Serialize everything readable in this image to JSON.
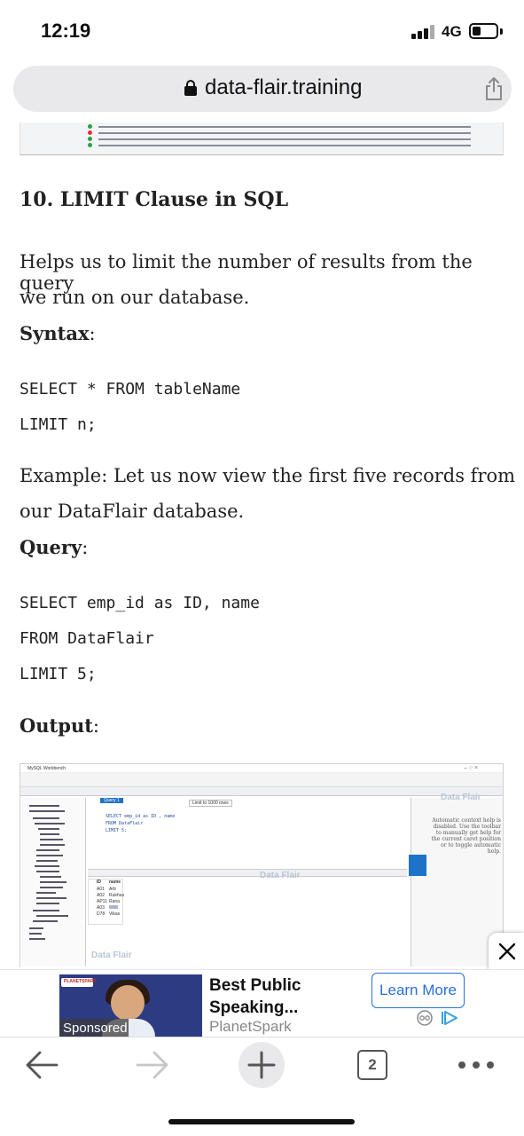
{
  "status_bar": {
    "time": "12:19",
    "network": "4G"
  },
  "browser": {
    "url": "data-flair.training",
    "open_tabs": "2"
  },
  "article": {
    "heading": "10. LIMIT Clause in SQL",
    "intro_line1": "Helps us to limit the number of results from the query",
    "intro_line2": "we run on our database.",
    "syntax_label": "Syntax",
    "syntax_code_line1": "SELECT * FROM tableName",
    "syntax_code_line2": "LIMIT n;",
    "example_line1": "Example: Let us now view the first five records from",
    "example_line2": "our DataFlair database.",
    "query_label": "Query",
    "query_code_line1": "SELECT emp_id as ID, name",
    "query_code_line2": "FROM DataFlair",
    "query_code_line3": "LIMIT 5;",
    "output_label": "Output",
    "colon": ":"
  },
  "screenshot": {
    "app_title": "MySQL Workbench",
    "query_tab": "Query 1",
    "editor_line1": "SELECT emp_id as ID , name",
    "editor_line2": "FROM DataFlair",
    "editor_line3": "LIMIT 5;",
    "limit_select": "Limit to 1000 rows",
    "help_text": "Automatic context help is disabled. Use the toolbar to manually get help for the current caret position or to toggle automatic help.",
    "grid_header": [
      "ID",
      "name"
    ],
    "grid_rows": [
      [
        "A01",
        "Arb"
      ],
      [
        "A02",
        "Rukhsa"
      ],
      [
        "AP11",
        "Rana"
      ],
      [
        "A03",
        ""
      ],
      [
        "D78",
        "Vikas"
      ]
    ],
    "watermark": "Data Flair"
  },
  "ad": {
    "title": "Best Public Speaking...",
    "brand": "PlanetSpark",
    "cta": "Learn More",
    "sponsored": "Sponsored",
    "logo_text": "PLANETSPARK"
  },
  "icons": {
    "lock": "lock-icon",
    "share": "share-icon",
    "back": "back-arrow-icon",
    "forward": "forward-arrow-icon",
    "new_tab": "plus-icon",
    "more": "more-icon",
    "close_ad": "close-icon"
  },
  "colors": {
    "accent_blue": "#2b6fd6",
    "url_bar_bg": "#e9e9eb",
    "disabled_icon": "#c7c7c7"
  }
}
